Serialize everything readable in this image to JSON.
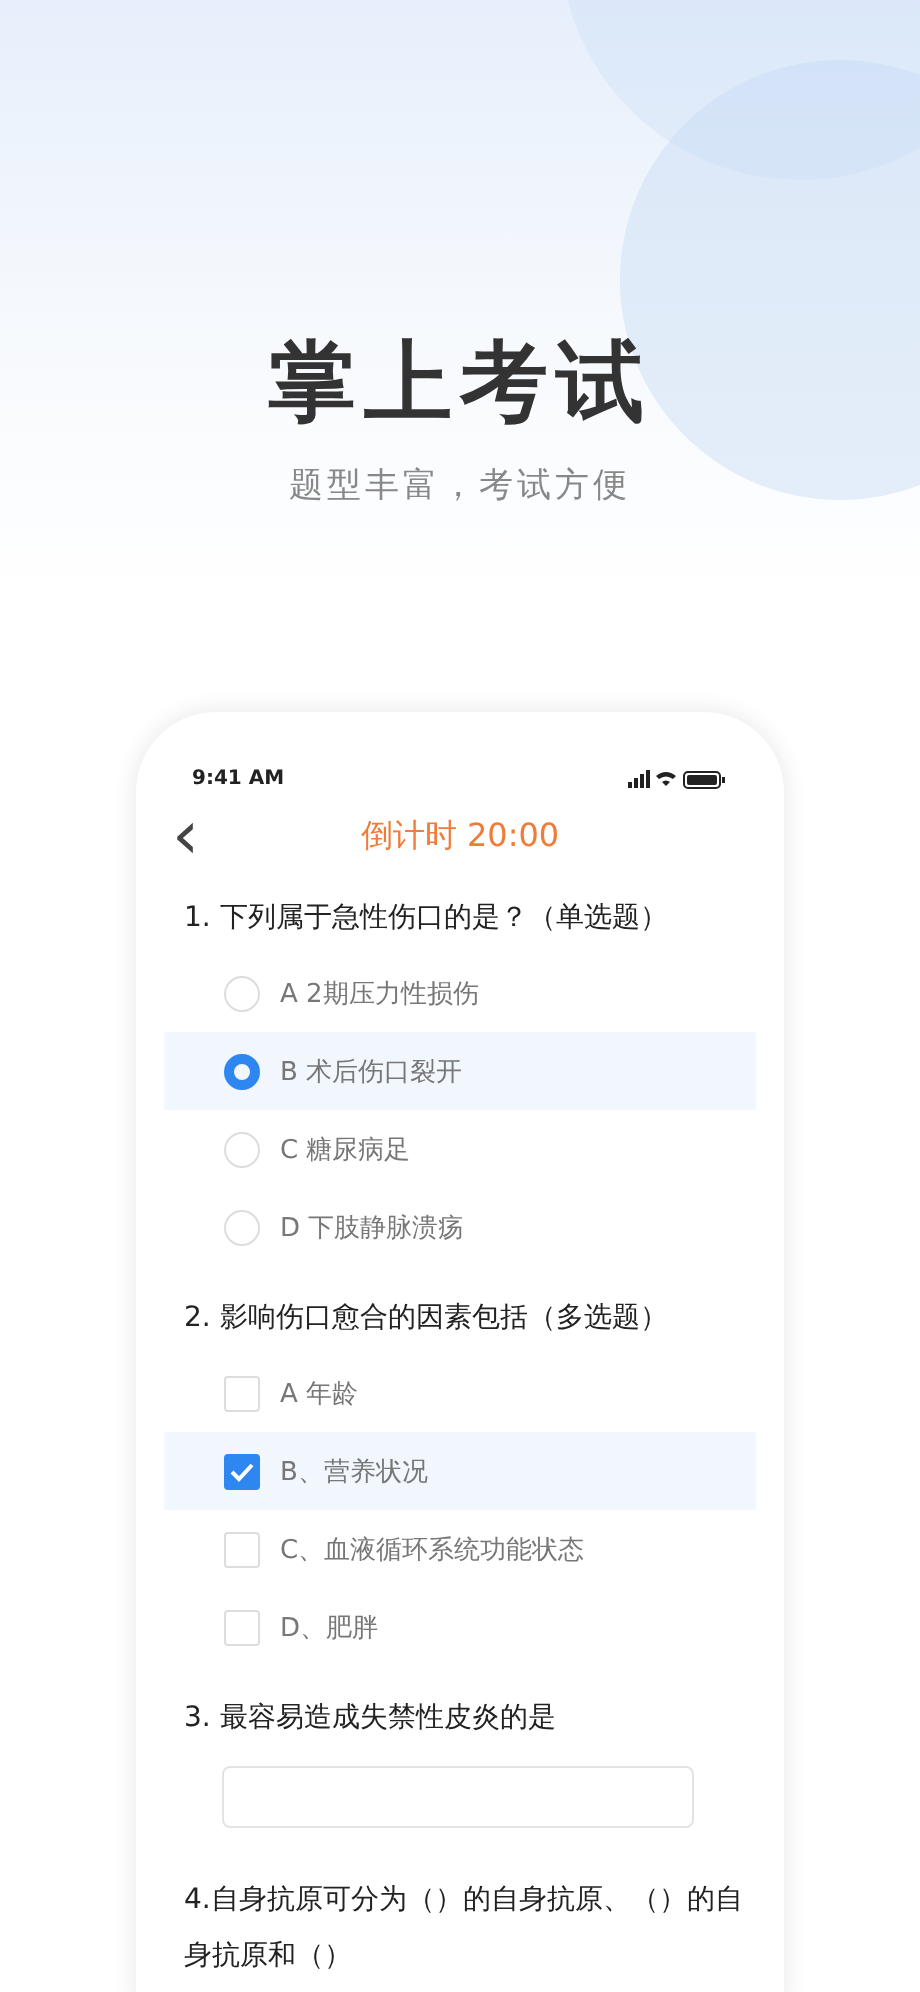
{
  "hero": {
    "title": "掌上考试",
    "subtitle": "题型丰富，考试方便"
  },
  "phone": {
    "status_bar": {
      "time": "9:41 AM"
    },
    "nav": {
      "back": "‹",
      "title": "倒计时 20:00"
    },
    "questions": [
      {
        "kind": "single",
        "title": "1. 下列属于急性伤口的是？（单选题）",
        "options": [
          {
            "label": "A  2期压力性损伤",
            "selected": false
          },
          {
            "label": "B  术后伤口裂开",
            "selected": true
          },
          {
            "label": "C 糖尿病足",
            "selected": false
          },
          {
            "label": "D 下肢静脉溃疡",
            "selected": false
          }
        ]
      },
      {
        "kind": "multi",
        "title": "2. 影响伤口愈合的因素包括（多选题）",
        "options": [
          {
            "label": "A 年龄",
            "selected": false
          },
          {
            "label": "B、营养状况",
            "selected": true
          },
          {
            "label": "C、血液循环系统功能状态",
            "selected": false
          },
          {
            "label": "D、肥胖",
            "selected": false
          }
        ]
      },
      {
        "kind": "fill",
        "title": "3. 最容易造成失禁性皮炎的是"
      },
      {
        "kind": "text",
        "title": "4.自身抗原可分为（）的自身抗原、（）的自身抗原和（）"
      }
    ]
  }
}
